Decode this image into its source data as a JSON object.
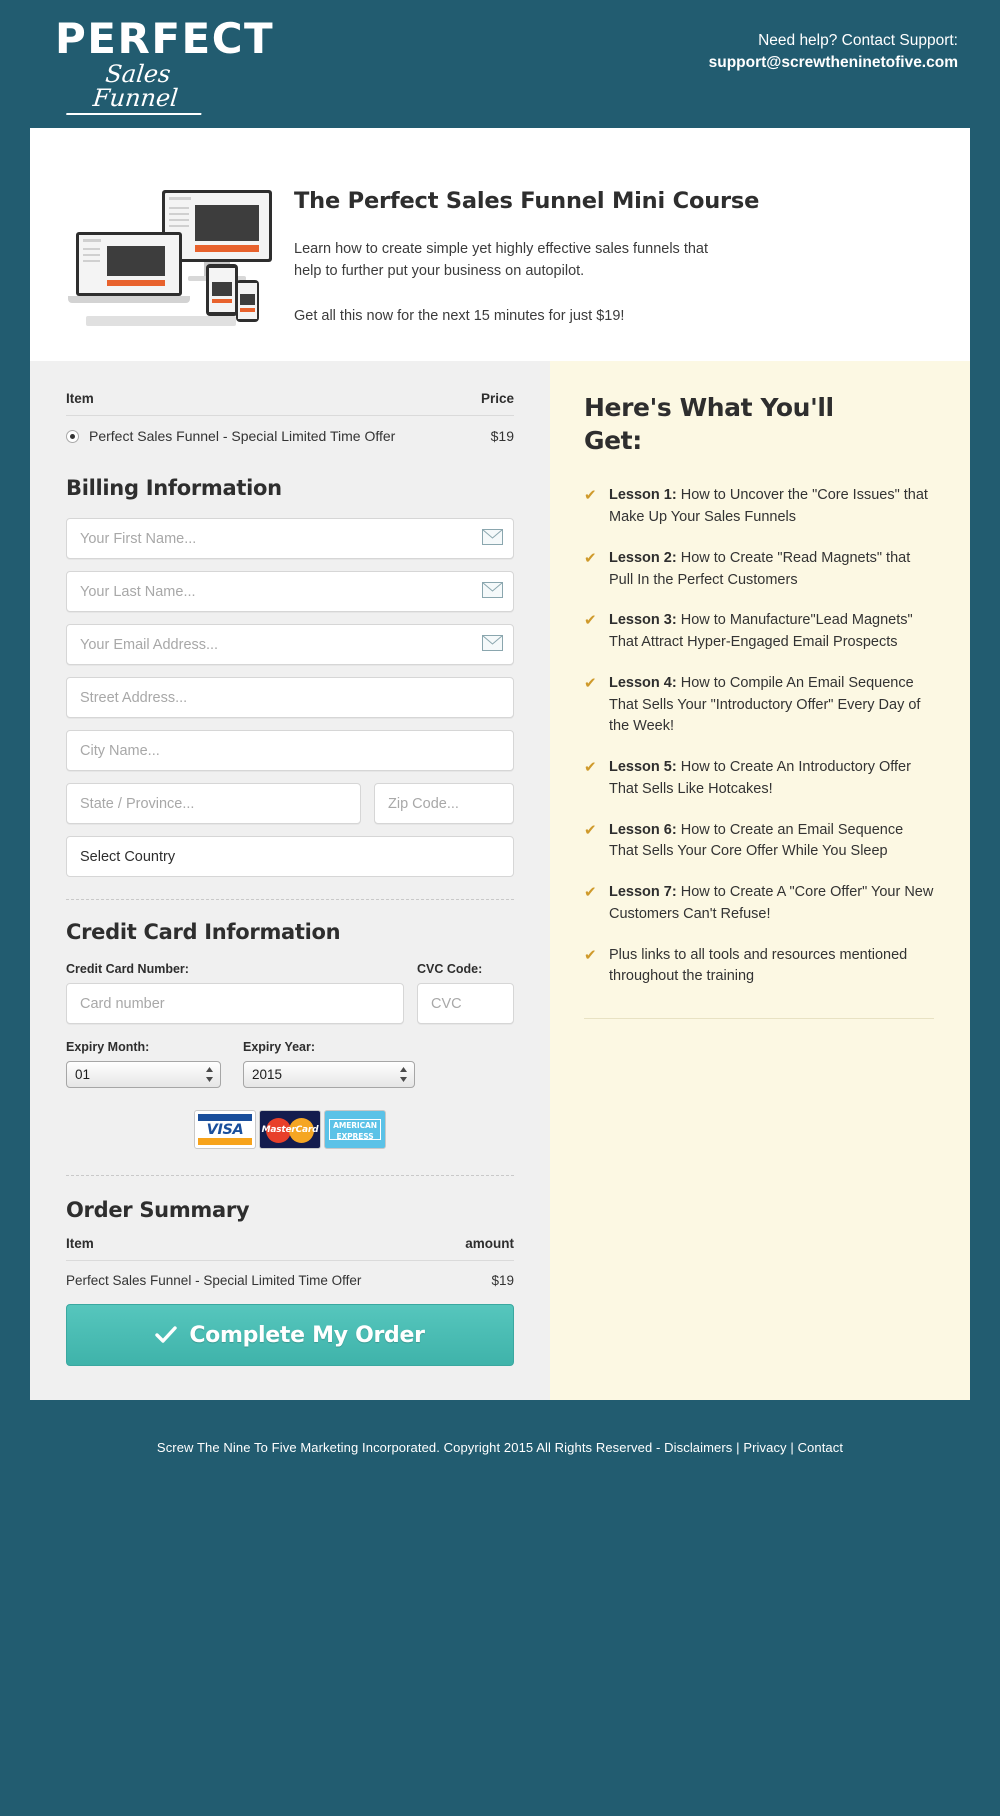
{
  "header": {
    "logo_main": "PERFECT",
    "logo_sub": "Sales Funnel",
    "support_line1": "Need help? Contact Support:",
    "support_email": "support@screwtheninetofive.com"
  },
  "hero": {
    "title": "The Perfect Sales Funnel Mini Course",
    "description": "Learn how to create simple yet highly effective sales funnels that help to further put your business on autopilot.",
    "price_line": "Get all this now for the next 15 minutes for just $19!"
  },
  "item_table": {
    "col_item": "Item",
    "col_price": "Price",
    "row_item": "Perfect Sales Funnel - Special Limited Time Offer",
    "row_price": "$19"
  },
  "billing": {
    "title": "Billing Information",
    "first_name_placeholder": "Your First Name...",
    "last_name_placeholder": "Your Last Name...",
    "email_placeholder": "Your Email Address...",
    "street_placeholder": "Street Address...",
    "city_placeholder": "City Name...",
    "state_placeholder": "State / Province...",
    "zip_placeholder": "Zip Code...",
    "country_selected": "Select Country",
    "first_name_value": "",
    "last_name_value": "",
    "email_value": "",
    "street_value": "",
    "city_value": "",
    "state_value": "",
    "zip_value": ""
  },
  "credit_card": {
    "title": "Credit Card Information",
    "number_label": "Credit Card Number:",
    "number_placeholder": "Card number",
    "number_value": "",
    "cvc_label": "CVC Code:",
    "cvc_placeholder": "CVC",
    "cvc_value": "",
    "expiry_month_label": "Expiry Month:",
    "expiry_month_selected": "01",
    "expiry_year_label": "Expiry Year:",
    "expiry_year_selected": "2015",
    "logos": [
      "VISA",
      "MasterCard",
      "AMERICAN EXPRESS"
    ]
  },
  "order_summary": {
    "title": "Order Summary",
    "col_item": "Item",
    "col_amount": "amount",
    "row_item": "Perfect Sales Funnel - Special Limited Time Offer",
    "row_amount": "$19",
    "cta_label": "Complete My Order"
  },
  "benefits": {
    "title": "Here's What You'll Get:",
    "items": [
      {
        "label": "Lesson 1:",
        "text": " How to Uncover the \"Core Issues\" that Make Up Your Sales Funnels"
      },
      {
        "label": "Lesson 2:",
        "text": " How to Create \"Read Magnets\" that Pull In the Perfect Customers"
      },
      {
        "label": "Lesson 3:",
        "text": " How to Manufacture\"Lead Magnets\" That Attract Hyper-Engaged Email Prospects"
      },
      {
        "label": "Lesson 4:",
        "text": " How to Compile An Email Sequence That Sells Your \"Introductory Offer\" Every Day of the Week!"
      },
      {
        "label": "Lesson 5:",
        "text": " How to Create An Introductory Offer That Sells Like Hotcakes!"
      },
      {
        "label": "Lesson 6:",
        "text": " How to Create an Email Sequence That Sells Your Core Offer While You Sleep"
      },
      {
        "label": "Lesson 7:",
        "text": " How to Create A \"Core Offer\" Your New Customers Can't Refuse!"
      },
      {
        "label": "",
        "text": "Plus links to all tools and resources mentioned throughout the training"
      }
    ]
  },
  "footer": {
    "copyright": "Screw The Nine To Five Marketing Incorporated. Copyright 2015 All Rights Reserved - ",
    "link_disclaimers": "Disclaimers",
    "sep1": " | ",
    "link_privacy": "Privacy",
    "sep2": " | ",
    "link_contact": "Contact"
  },
  "colors": {
    "brand_dark": "#225C70",
    "cta_teal": "#49bdb3",
    "benefit_bg": "#fcf8e3",
    "check_gold": "#cf9a2b"
  }
}
